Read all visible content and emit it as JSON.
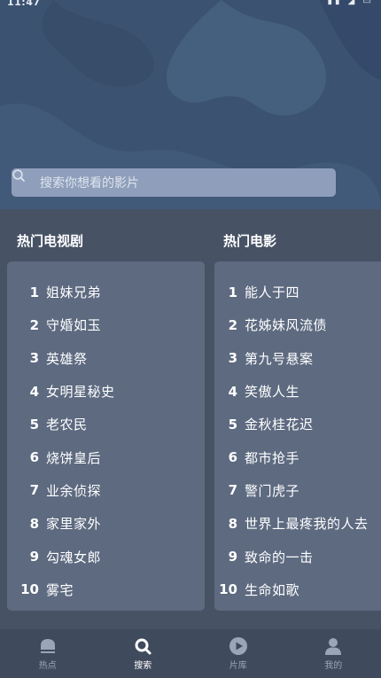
{
  "status": {
    "time": "11:47",
    "icons": "▮▮ ◢ ▭"
  },
  "search": {
    "placeholder": "搜索你想看的影片"
  },
  "hot_tv": {
    "heading": "热门电视剧",
    "items": [
      {
        "rank": "1",
        "title": "姐妹兄弟"
      },
      {
        "rank": "2",
        "title": "守婚如玉"
      },
      {
        "rank": "3",
        "title": "英雄祭"
      },
      {
        "rank": "4",
        "title": "女明星秘史"
      },
      {
        "rank": "5",
        "title": "老农民"
      },
      {
        "rank": "6",
        "title": "烧饼皇后"
      },
      {
        "rank": "7",
        "title": "业余侦探"
      },
      {
        "rank": "8",
        "title": "家里家外"
      },
      {
        "rank": "9",
        "title": "勾魂女郎"
      },
      {
        "rank": "10",
        "title": "雾宅"
      }
    ]
  },
  "hot_movies": {
    "heading": "热门电影",
    "items": [
      {
        "rank": "1",
        "title": "能人于四"
      },
      {
        "rank": "2",
        "title": "花姊妹风流债"
      },
      {
        "rank": "3",
        "title": "第九号悬案"
      },
      {
        "rank": "4",
        "title": "笑傲人生"
      },
      {
        "rank": "5",
        "title": "金秋桂花迟"
      },
      {
        "rank": "6",
        "title": "都市抢手"
      },
      {
        "rank": "7",
        "title": "警门虎子"
      },
      {
        "rank": "8",
        "title": "世界上最疼我的人去"
      },
      {
        "rank": "9",
        "title": "致命的一击"
      },
      {
        "rank": "10",
        "title": "生命如歌"
      }
    ]
  },
  "tabbar": {
    "tabs": [
      {
        "label": "热点",
        "icon": "hot-icon",
        "active": false
      },
      {
        "label": "搜索",
        "icon": "search-icon",
        "active": true
      },
      {
        "label": "片库",
        "icon": "play-icon",
        "active": false
      },
      {
        "label": "我的",
        "icon": "user-icon",
        "active": false
      }
    ]
  },
  "colors": {
    "hero_bg": "#3b5270",
    "content_bg": "#475265",
    "panel_bg": "#5d6a80",
    "tabbar_bg": "#3f4a5c",
    "search_bg": "#8f9fbb"
  }
}
